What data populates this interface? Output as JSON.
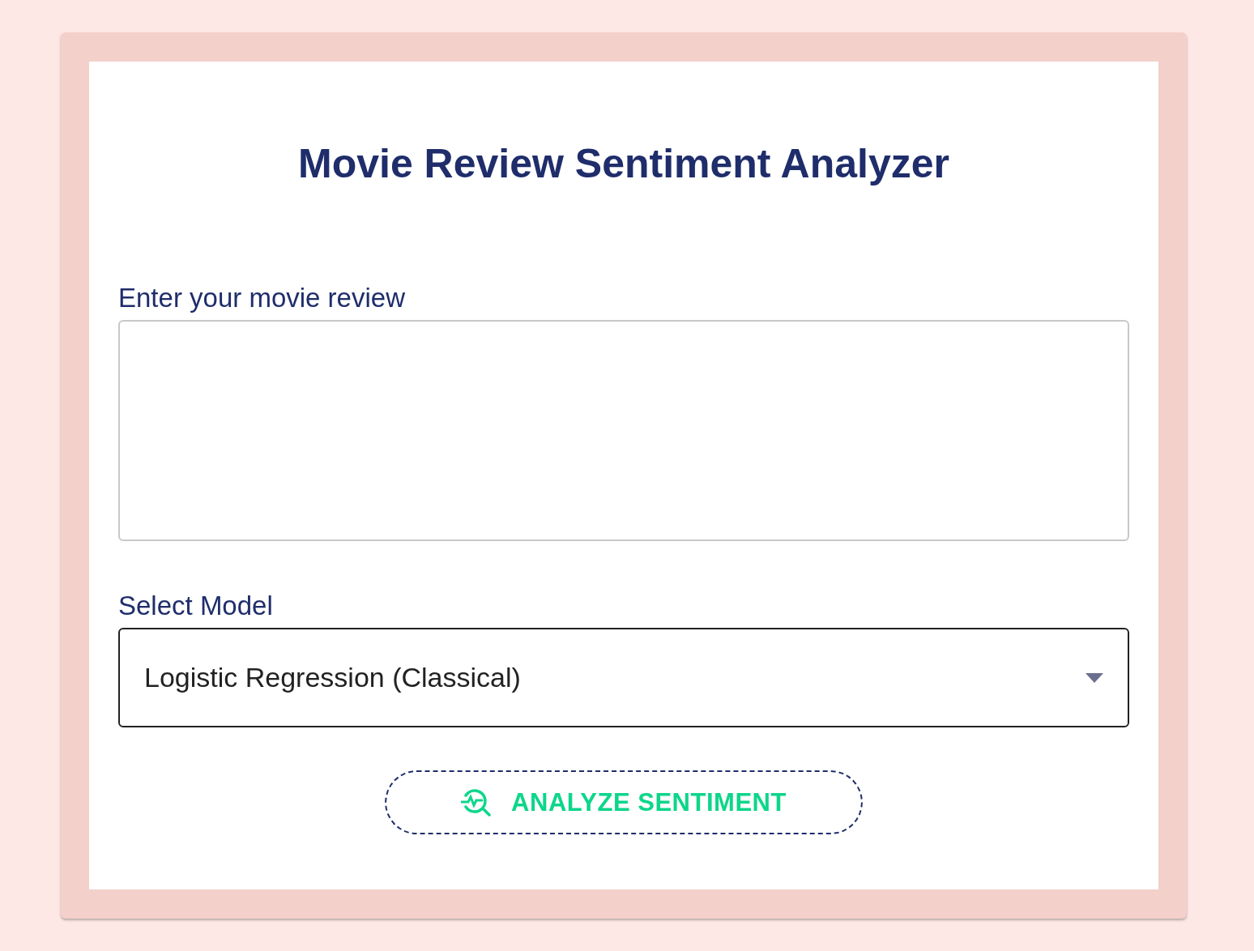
{
  "title": "Movie Review Sentiment Analyzer",
  "review_field": {
    "label": "Enter your movie review"
  },
  "model_field": {
    "label": "Select Model",
    "value": "Logistic Regression (Classical)"
  },
  "analyze_button": {
    "label": "ANALYZE SENTIMENT"
  }
}
